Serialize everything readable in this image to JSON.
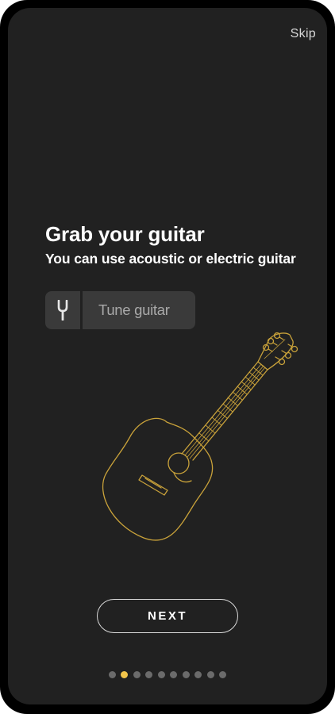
{
  "header": {
    "skip_label": "Skip"
  },
  "onboarding": {
    "title": "Grab your guitar",
    "subtitle": "You can use acoustic or electric guitar",
    "tune_button": {
      "label": "Tune guitar",
      "icon": "tuning-fork-icon"
    },
    "illustration": "acoustic-guitar-illustration",
    "next_label": "NEXT"
  },
  "pagination": {
    "total_pages": 10,
    "current_page": 2
  },
  "colors": {
    "background": "#212121",
    "accent": "#f2c54b",
    "guitar_outline": "#c9a23a",
    "dot_inactive": "#6b6b6b",
    "pill": "#3a3a3a"
  }
}
